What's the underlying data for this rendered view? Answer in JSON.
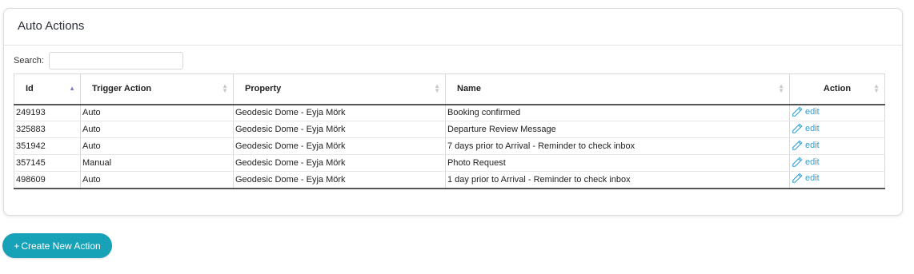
{
  "panel": {
    "title": "Auto Actions"
  },
  "search": {
    "label": "Search:",
    "value": "",
    "placeholder": ""
  },
  "table": {
    "columns": [
      {
        "key": "id",
        "label": "Id",
        "sort": "asc"
      },
      {
        "key": "trigger",
        "label": "Trigger Action",
        "sort": "none"
      },
      {
        "key": "property",
        "label": "Property",
        "sort": "none"
      },
      {
        "key": "name",
        "label": "Name",
        "sort": "none"
      },
      {
        "key": "action",
        "label": "Action",
        "sort": "none"
      }
    ],
    "rows": [
      {
        "id": "249193",
        "trigger": "Auto",
        "property": "Geodesic Dome - Eyja Mörk",
        "name": "Booking confirmed",
        "action": "edit"
      },
      {
        "id": "325883",
        "trigger": "Auto",
        "property": "Geodesic Dome - Eyja Mörk",
        "name": "Departure Review Message",
        "action": "edit"
      },
      {
        "id": "351942",
        "trigger": "Auto",
        "property": "Geodesic Dome - Eyja Mörk",
        "name": "7 days prior to Arrival - Reminder to check inbox",
        "action": "edit"
      },
      {
        "id": "357145",
        "trigger": "Manual",
        "property": "Geodesic Dome - Eyja Mörk",
        "name": "Photo Request",
        "action": "edit"
      },
      {
        "id": "498609",
        "trigger": "Auto",
        "property": "Geodesic Dome - Eyja Mörk",
        "name": "1 day prior to Arrival - Reminder to check inbox",
        "action": "edit"
      }
    ]
  },
  "create_button": {
    "icon": "+",
    "label": "Create New Action"
  },
  "colors": {
    "accent": "#17a2b8",
    "link": "#2a9fd6",
    "sort_active": "#7d7fc7"
  },
  "icons": {
    "edit": "pencil-icon",
    "sort": "sort-icon"
  }
}
